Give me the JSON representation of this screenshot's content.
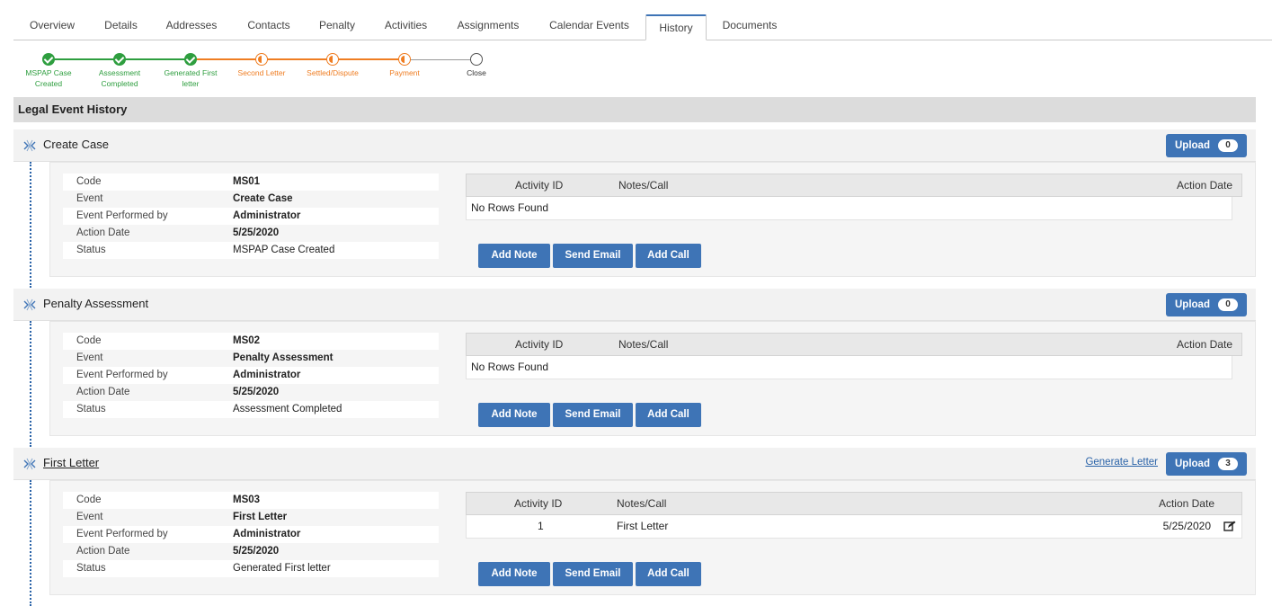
{
  "tabs": [
    "Overview",
    "Details",
    "Addresses",
    "Contacts",
    "Penalty",
    "Activities",
    "Assignments",
    "Calendar Events",
    "History",
    "Documents"
  ],
  "active_tab": "History",
  "stepper": {
    "steps": [
      {
        "label": "MSPAP Case Created",
        "state": "done"
      },
      {
        "label": "Assessment Completed",
        "state": "done"
      },
      {
        "label": "Generated First letter",
        "state": "done"
      },
      {
        "label": "Second Letter",
        "state": "current"
      },
      {
        "label": "Settled/Dispute",
        "state": "current"
      },
      {
        "label": "Payment",
        "state": "current"
      },
      {
        "label": "Close",
        "state": "pending"
      }
    ],
    "colors": {
      "done": "#2e9e3f",
      "current": "#ef7d22",
      "pending": "#555555"
    }
  },
  "section_title": "Legal Event History",
  "labels": {
    "code": "Code",
    "event": "Event",
    "performed_by": "Event Performed by",
    "action_date": "Action Date",
    "status": "Status",
    "col_activity_id": "Activity ID",
    "col_notes": "Notes/Call",
    "col_action_date": "Action Date",
    "no_rows": "No Rows Found",
    "add_note": "Add Note",
    "send_email": "Send Email",
    "add_call": "Add Call",
    "upload": "Upload",
    "generate_letter": "Generate Letter"
  },
  "events": [
    {
      "name": "Create Case",
      "is_link": false,
      "upload_count": "0",
      "code": "MS01",
      "event": "Create Case",
      "performed_by": "Administrator",
      "action_date": "5/25/2020",
      "status": "MSPAP Case Created",
      "rows": []
    },
    {
      "name": "Penalty Assessment",
      "is_link": false,
      "upload_count": "0",
      "code": "MS02",
      "event": "Penalty Assessment",
      "performed_by": "Administrator",
      "action_date": "5/25/2020",
      "status": "Assessment Completed",
      "rows": []
    },
    {
      "name": "First Letter",
      "is_link": true,
      "upload_count": "3",
      "code": "MS03",
      "event": "First Letter",
      "performed_by": "Administrator",
      "action_date": "5/25/2020",
      "status": "Generated First letter",
      "rows": [
        {
          "activity_id": "1",
          "notes": "First Letter",
          "action_date": "5/25/2020"
        }
      ]
    }
  ],
  "colors": {
    "accent": "#3e74b6",
    "link": "#2a63a8"
  }
}
